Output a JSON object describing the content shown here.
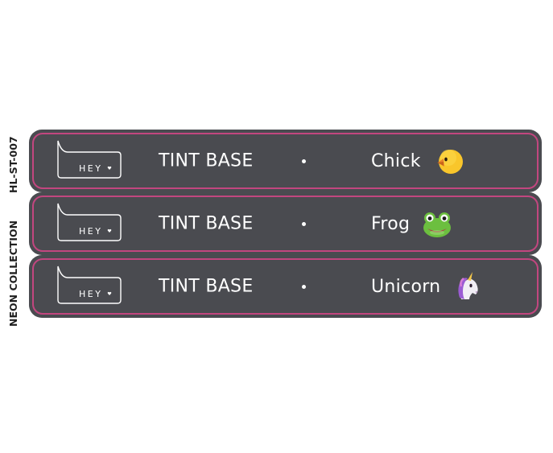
{
  "side_label": {
    "collection": "NEON COLLECTION",
    "code": "HL-ST-007"
  },
  "strips": [
    {
      "badge_text": "HEY",
      "base_label": "TINT BASE",
      "animal": "Chick",
      "icon": "chick-icon"
    },
    {
      "badge_text": "HEY",
      "base_label": "TINT BASE",
      "animal": "Frog",
      "icon": "frog-icon"
    },
    {
      "badge_text": "HEY",
      "base_label": "TINT BASE",
      "animal": "Unicorn",
      "icon": "unicorn-icon"
    }
  ],
  "colors": {
    "strip_background": "#4a4b50",
    "strip_border": "#c2467f",
    "text": "#ffffff"
  }
}
